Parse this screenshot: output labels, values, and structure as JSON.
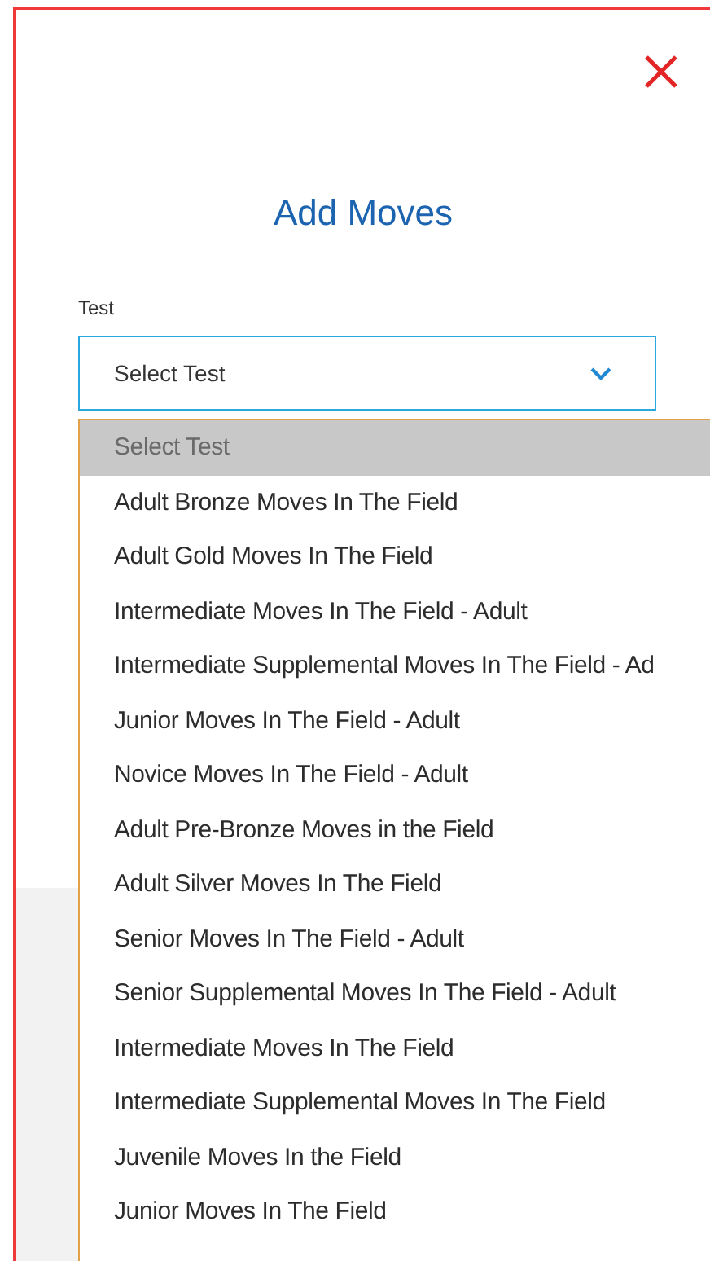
{
  "dialog": {
    "title": "Add Moves"
  },
  "field": {
    "label": "Test",
    "value": "Select Test",
    "expanded": true
  },
  "options": [
    {
      "label": "Select Test",
      "selected": true
    },
    {
      "label": "Adult Bronze Moves In The Field",
      "selected": false
    },
    {
      "label": "Adult Gold Moves In The Field",
      "selected": false
    },
    {
      "label": "Intermediate Moves In The Field - Adult",
      "selected": false
    },
    {
      "label": "Intermediate Supplemental Moves In The Field - Ad",
      "selected": false
    },
    {
      "label": "Junior Moves In The Field - Adult",
      "selected": false
    },
    {
      "label": "Novice Moves In The Field - Adult",
      "selected": false
    },
    {
      "label": "Adult Pre-Bronze Moves in the Field",
      "selected": false
    },
    {
      "label": "Adult Silver Moves In The Field",
      "selected": false
    },
    {
      "label": "Senior Moves In The Field - Adult",
      "selected": false
    },
    {
      "label": "Senior Supplemental Moves In The Field - Adult",
      "selected": false
    },
    {
      "label": "Intermediate Moves In The Field",
      "selected": false
    },
    {
      "label": "Intermediate Supplemental Moves In The Field",
      "selected": false
    },
    {
      "label": "Juvenile Moves In the Field",
      "selected": false
    },
    {
      "label": "Junior Moves In The Field",
      "selected": false
    }
  ]
}
